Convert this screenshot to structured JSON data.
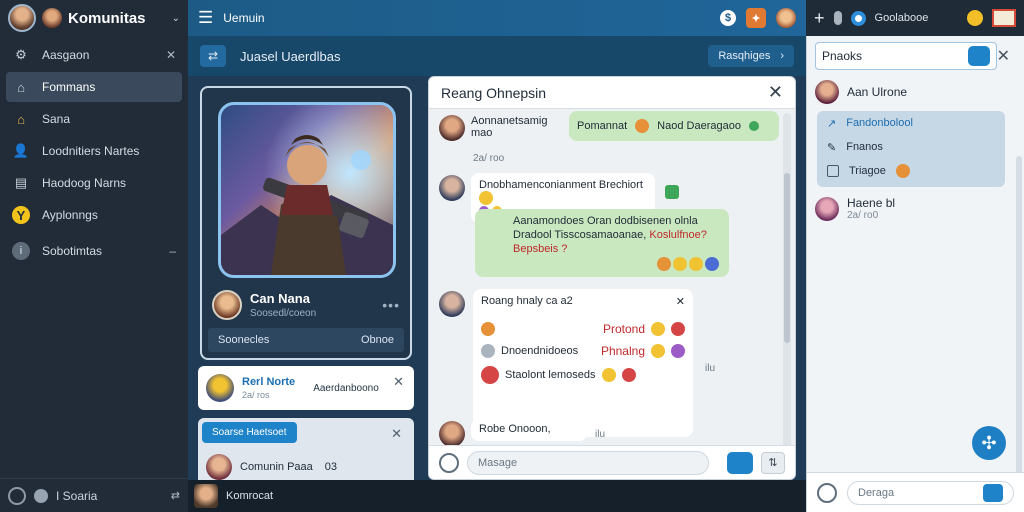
{
  "sidebar": {
    "title": "Komunitas",
    "items": [
      {
        "label": "Aasgaon",
        "icon": "gears-icon",
        "trail": "✕"
      },
      {
        "label": "Fommans",
        "icon": "home-icon",
        "active": true
      },
      {
        "label": "Sana",
        "icon": "house-icon"
      },
      {
        "label": "Loodnitiers Nartes",
        "icon": "user-icon"
      },
      {
        "label": "Haodoog Narns",
        "icon": "document-icon"
      },
      {
        "label": "Ayplonngs",
        "icon": "lightbulb-icon"
      },
      {
        "label": "Sobotimtas",
        "icon": "info-icon",
        "trail": "–"
      }
    ],
    "footer": {
      "label": "I Soaria"
    }
  },
  "topbar": {
    "title": "Uemuin"
  },
  "rtopbar": {
    "label": "Goolabooe"
  },
  "subbar": {
    "title": "Juasel Uaerdlbas",
    "button": "Rasqhiges",
    "button_arrow": "›"
  },
  "card": {
    "user_name": "Can Nana",
    "user_sub": "Soosedl/coeon",
    "more": "•••",
    "footer_left": "Soonecles",
    "footer_right": "Obnoe"
  },
  "notif": {
    "title": "Rerl Norte",
    "sub": "2a/ ros",
    "message": "Aaerdanboono",
    "close": "✕"
  },
  "panel2": {
    "tag": "Soarse  Haetsoet",
    "close": "✕",
    "row_name": "Comunin Paaa",
    "row_num": "03"
  },
  "midbottom": {
    "label": "Komrocat"
  },
  "chat": {
    "title": "Reang Ohnepsin",
    "close": "✕",
    "messages": {
      "m1_line1": "Aonnanetsamig",
      "m1_line2": "mao",
      "m1_time": "2a/ roo",
      "m2": "Pomannat",
      "m2b": "Naod Daeragaoo",
      "m3": "Dnobhamenconianment  Brechiort",
      "m4_line1": "Aanamondoes Oran dodbisenen olnla",
      "m4_line2a": "Dradool Tisscosamaoanae,",
      "m4_line2b": "Koslulfnoe?",
      "m4_line3": "Bepsbeis ?",
      "m5": "Roang hnaly ca a2",
      "m5_close": "✕",
      "m6": "Protond",
      "m7": "Dnoendnidoeos",
      "m7b": "Phnalng",
      "m7_side": "ilu",
      "m8": "Staolont lemoseds",
      "m9": "Robe Onooon,",
      "m9_side": "ilu"
    },
    "input_placeholder": "Masage",
    "send2": "⇅"
  },
  "rpanel": {
    "search_value": "Pnaoks",
    "close": "✕",
    "row1": "Aan Ulrone",
    "box_items": [
      {
        "label": "Fandonbolool",
        "icon": "trend-icon",
        "active": true
      },
      {
        "label": "Fnanos",
        "icon": "edit-icon"
      },
      {
        "label": "Triagoe",
        "icon": "list-icon"
      }
    ],
    "row2_name": "Haene bl",
    "row2_sub": "2a/ ro0",
    "input_placeholder": "Deraga"
  },
  "colors": {
    "accent": "#1e83c8",
    "sidebar": "#222c38",
    "topbar": "#1d5b86",
    "green_bubble": "#c9e8c0"
  }
}
